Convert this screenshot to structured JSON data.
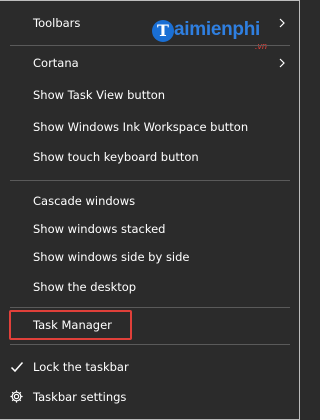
{
  "menu": {
    "toolbars": "Toolbars",
    "cortana": "Cortana",
    "show_task_view": "Show Task View button",
    "show_ink_workspace": "Show Windows Ink Workspace button",
    "show_touch_keyboard": "Show touch keyboard button",
    "cascade_windows": "Cascade windows",
    "show_stacked": "Show windows stacked",
    "show_side_by_side": "Show windows side by side",
    "show_desktop": "Show the desktop",
    "task_manager": "Task Manager",
    "lock_taskbar": "Lock the taskbar",
    "taskbar_settings": "Taskbar settings"
  },
  "watermark": {
    "logo_letter": "T",
    "logo_text": "aimienphi",
    "logo_suffix": ".vn"
  },
  "colors": {
    "menu_background": "#2b2b2b",
    "text": "#ffffff",
    "highlight_border": "#e0403a",
    "separator": "#5a5a5a"
  },
  "icons": {
    "submenu": "chevron-right-icon",
    "checked": "checkmark-icon",
    "settings": "gear-icon"
  }
}
